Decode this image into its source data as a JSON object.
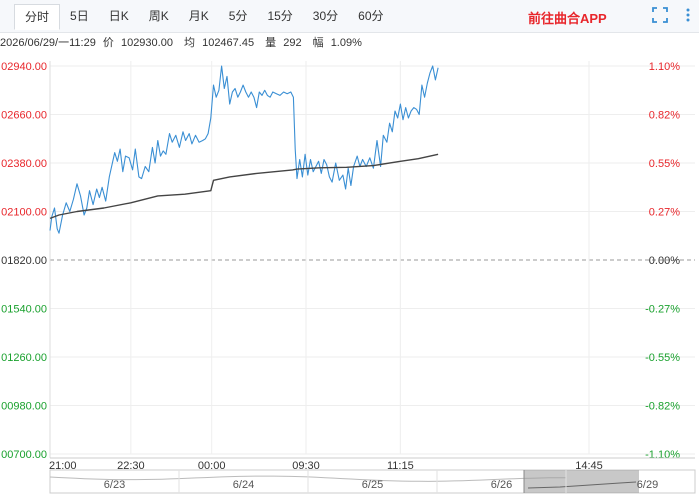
{
  "tabs": [
    {
      "label": "分时",
      "active": true
    },
    {
      "label": "5日"
    },
    {
      "label": "日K"
    },
    {
      "label": "周K"
    },
    {
      "label": "月K"
    },
    {
      "label": "5分"
    },
    {
      "label": "15分"
    },
    {
      "label": "30分"
    },
    {
      "label": "60分"
    }
  ],
  "app_link": "前往曲合APP",
  "icons": {
    "fullscreen": "fullscreen-icon",
    "more": "more-vertical-icon"
  },
  "info": {
    "datetime": "2026/06/29/一11:29",
    "price_label": "价",
    "price": "102930.00",
    "avg_label": "均",
    "avg": "102467.45",
    "vol_label": "量",
    "vol": "292",
    "change_label": "幅",
    "change": "1.09%"
  },
  "colors": {
    "up": "#e8262b",
    "down": "#1aa12e",
    "flat": "#333333",
    "price_line": "#3a8fd4",
    "avg_line": "#444444"
  },
  "chart_data": {
    "type": "line",
    "y_tick_labels": [
      "02940.00",
      "02660.00",
      "02380.00",
      "02100.00",
      "01820.00",
      "01540.00",
      "01260.00",
      "00980.00",
      "00700.00"
    ],
    "y_ticks": [
      102940,
      102660,
      102380,
      102100,
      101820,
      101540,
      101260,
      100980,
      100700
    ],
    "pct_ticks": [
      "1.10%",
      "0.82%",
      "0.55%",
      "0.27%",
      "0.00%",
      "-0.27%",
      "-0.55%",
      "-0.82%",
      "-1.10%"
    ],
    "ylim": [
      100700,
      102940
    ],
    "base": 101820,
    "x_tick_labels": [
      "21:00",
      "22:30",
      "00:00",
      "09:30",
      "11:15",
      "14:45"
    ],
    "x_ticks_min": [
      0,
      90,
      180,
      285,
      390,
      600
    ],
    "xlim_min": [
      0,
      600
    ],
    "nav_dates": [
      "6/23",
      "6/24",
      "6/25",
      "6/26",
      "6/29"
    ],
    "series": [
      {
        "key": "price",
        "points": [
          [
            0,
            101990
          ],
          [
            2,
            102070
          ],
          [
            5,
            102120
          ],
          [
            8,
            102000
          ],
          [
            10,
            101975
          ],
          [
            14,
            102080
          ],
          [
            18,
            102150
          ],
          [
            22,
            102100
          ],
          [
            26,
            102170
          ],
          [
            30,
            102260
          ],
          [
            34,
            102190
          ],
          [
            38,
            102080
          ],
          [
            41,
            102120
          ],
          [
            44,
            102220
          ],
          [
            48,
            102140
          ],
          [
            52,
            102230
          ],
          [
            55,
            102180
          ],
          [
            58,
            102240
          ],
          [
            62,
            102160
          ],
          [
            66,
            102300
          ],
          [
            69,
            102370
          ],
          [
            72,
            102440
          ],
          [
            75,
            102390
          ],
          [
            78,
            102460
          ],
          [
            81,
            102330
          ],
          [
            84,
            102420
          ],
          [
            88,
            102410
          ],
          [
            92,
            102340
          ],
          [
            95,
            102460
          ],
          [
            99,
            102300
          ],
          [
            102,
            102290
          ],
          [
            106,
            102360
          ],
          [
            110,
            102330
          ],
          [
            114,
            102470
          ],
          [
            117,
            102380
          ],
          [
            120,
            102510
          ],
          [
            123,
            102420
          ],
          [
            126,
            102450
          ],
          [
            129,
            102430
          ],
          [
            133,
            102550
          ],
          [
            136,
            102500
          ],
          [
            140,
            102540
          ],
          [
            144,
            102470
          ],
          [
            148,
            102560
          ],
          [
            151,
            102510
          ],
          [
            155,
            102550
          ],
          [
            158,
            102490
          ],
          [
            162,
            102540
          ],
          [
            166,
            102500
          ],
          [
            170,
            102510
          ],
          [
            173,
            102520
          ],
          [
            176,
            102550
          ],
          [
            179,
            102640
          ],
          [
            182,
            102830
          ],
          [
            185,
            102760
          ],
          [
            188,
            102800
          ],
          [
            191,
            102940
          ],
          [
            194,
            102810
          ],
          [
            197,
            102880
          ],
          [
            200,
            102720
          ],
          [
            203,
            102790
          ],
          [
            206,
            102810
          ],
          [
            209,
            102760
          ],
          [
            212,
            102790
          ],
          [
            215,
            102830
          ],
          [
            218,
            102790
          ],
          [
            221,
            102760
          ],
          [
            224,
            102790
          ],
          [
            227,
            102760
          ],
          [
            230,
            102700
          ],
          [
            233,
            102790
          ],
          [
            236,
            102770
          ],
          [
            239,
            102800
          ],
          [
            242,
            102770
          ],
          [
            245,
            102760
          ],
          [
            248,
            102790
          ],
          [
            252,
            102780
          ],
          [
            256,
            102770
          ],
          [
            260,
            102790
          ],
          [
            264,
            102780
          ],
          [
            268,
            102790
          ],
          [
            271,
            102760
          ],
          [
            273,
            102460
          ],
          [
            275,
            102290
          ],
          [
            278,
            102400
          ],
          [
            281,
            102300
          ],
          [
            284,
            102430
          ],
          [
            287,
            102310
          ],
          [
            290,
            102400
          ],
          [
            293,
            102330
          ],
          [
            296,
            102360
          ],
          [
            299,
            102390
          ],
          [
            302,
            102320
          ],
          [
            305,
            102400
          ],
          [
            308,
            102370
          ],
          [
            311,
            102300
          ],
          [
            314,
            102270
          ],
          [
            318,
            102380
          ],
          [
            322,
            102280
          ],
          [
            326,
            102310
          ],
          [
            329,
            102230
          ],
          [
            332,
            102350
          ],
          [
            335,
            102250
          ],
          [
            338,
            102360
          ],
          [
            342,
            102420
          ],
          [
            345,
            102360
          ],
          [
            348,
            102400
          ],
          [
            352,
            102360
          ],
          [
            356,
            102410
          ],
          [
            360,
            102350
          ],
          [
            364,
            102510
          ],
          [
            368,
            102360
          ],
          [
            371,
            102540
          ],
          [
            375,
            102500
          ],
          [
            378,
            102610
          ],
          [
            381,
            102560
          ],
          [
            384,
            102680
          ],
          [
            387,
            102640
          ],
          [
            390,
            102720
          ],
          [
            393,
            102630
          ],
          [
            396,
            102700
          ],
          [
            399,
            102640
          ],
          [
            402,
            102680
          ],
          [
            405,
            102700
          ],
          [
            408,
            102690
          ],
          [
            411,
            102660
          ],
          [
            414,
            102830
          ],
          [
            417,
            102760
          ],
          [
            420,
            102840
          ],
          [
            423,
            102900
          ],
          [
            426,
            102940
          ],
          [
            429,
            102860
          ],
          [
            432,
            102930
          ]
        ]
      },
      {
        "key": "avg",
        "points": [
          [
            0,
            102060
          ],
          [
            10,
            102080
          ],
          [
            30,
            102100
          ],
          [
            60,
            102120
          ],
          [
            90,
            102150
          ],
          [
            120,
            102190
          ],
          [
            150,
            102200
          ],
          [
            179,
            102220
          ],
          [
            182,
            102280
          ],
          [
            200,
            102300
          ],
          [
            230,
            102320
          ],
          [
            270,
            102340
          ],
          [
            275,
            102345
          ],
          [
            300,
            102352
          ],
          [
            330,
            102355
          ],
          [
            360,
            102365
          ],
          [
            390,
            102390
          ],
          [
            410,
            102405
          ],
          [
            432,
            102430
          ]
        ]
      }
    ]
  }
}
